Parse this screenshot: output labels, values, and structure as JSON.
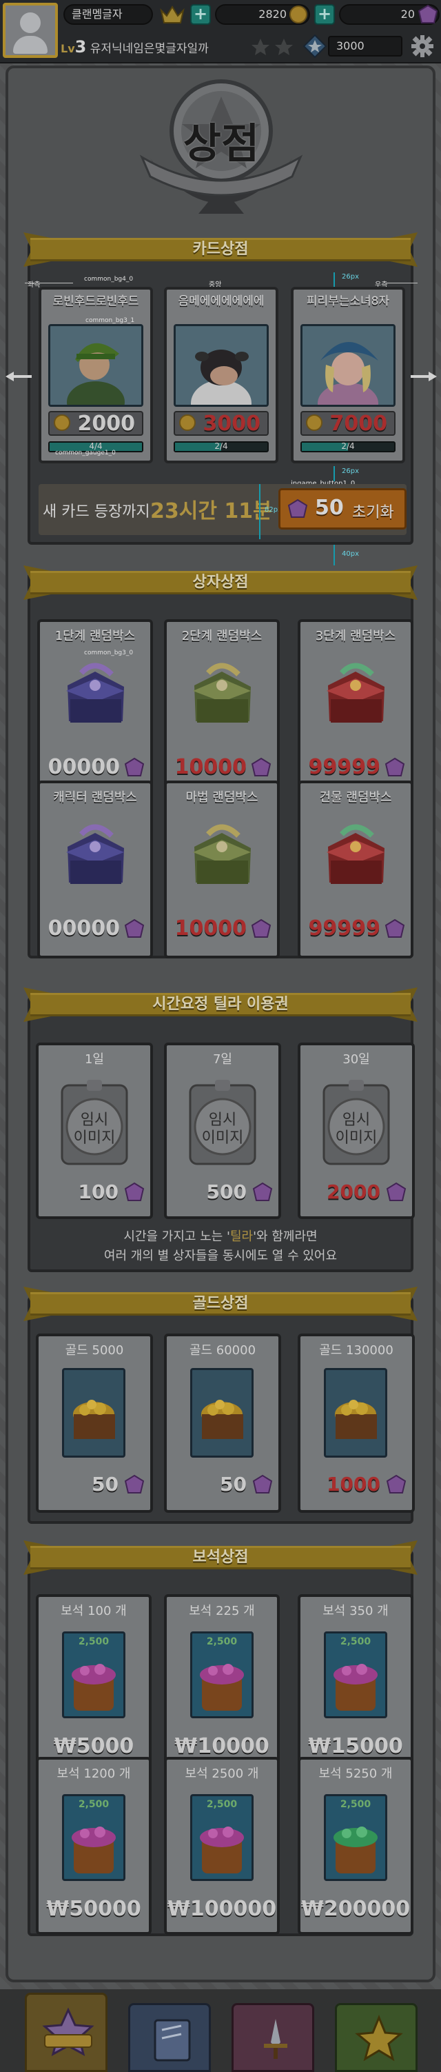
{
  "header": {
    "username": "클랜멤글자",
    "gold": "2820",
    "gems": "20",
    "level_prefix": "Lv",
    "level": "3",
    "nickname": "유저닉네임은몇글자일까",
    "rating": "3000"
  },
  "page_title": "상점",
  "card_shop": {
    "title": "카드상점",
    "annotations": {
      "left": "좌측",
      "center": "중앙",
      "right": "우측",
      "bg4": "common_bg4_0",
      "bg3": "common_bg3_1",
      "gauge": "common_gauge1_0",
      "btn": "ingame_button1_0",
      "gap26a": "26px",
      "gap26b": "26px",
      "gap82": "82px",
      "gap40": "40px",
      "gap14": "14px"
    },
    "cards": [
      {
        "name": "로빈후드로빈후드",
        "price": "2000",
        "gauge": "4/4",
        "progress": 1.0
      },
      {
        "name": "음메에에에에에에",
        "price": "3000",
        "gauge": "2/4",
        "progress": 0.5
      },
      {
        "name": "피리부는소녀8자",
        "price": "7000",
        "gauge": "2/4",
        "progress": 0.5
      }
    ],
    "timer_label": "새 카드 등장까지",
    "timer_value": "23시간 11분",
    "reset_count": "50",
    "reset_label": "초기화"
  },
  "box_shop": {
    "title": "상자상점",
    "annotation": "common_bg3_0",
    "boxes": [
      {
        "name": "1단계 랜덤박스",
        "price": "00000"
      },
      {
        "name": "2단계 랜덤박스",
        "price": "10000"
      },
      {
        "name": "3단계 랜덤박스",
        "price": "99999"
      },
      {
        "name": "캐릭터 랜덤박스",
        "price": "00000"
      },
      {
        "name": "마법 랜덤박스",
        "price": "10000"
      },
      {
        "name": "건물 랜덤박스",
        "price": "99999"
      }
    ]
  },
  "ticket_shop": {
    "title": "시간요정 틸라 이용권",
    "tickets": [
      {
        "name": "1일",
        "price": "100",
        "glyph": "임시\n이미지"
      },
      {
        "name": "7일",
        "price": "500",
        "glyph": "임시\n이미지"
      },
      {
        "name": "30일",
        "price": "2000",
        "glyph": "임시\n이미지"
      }
    ],
    "desc_line1_a": "시간을 가지고 노는 '",
    "desc_highlight": "틸라",
    "desc_line1_b": "'와 함께라면",
    "desc_line2": "여러 개의 별 상자들을 동시에도 열 수 있어요"
  },
  "gold_shop": {
    "title": "골드상점",
    "items": [
      {
        "name": "골드 5000",
        "price": "50"
      },
      {
        "name": "골드 60000",
        "price": "50"
      },
      {
        "name": "골드 130000",
        "price": "1000"
      }
    ]
  },
  "gem_shop": {
    "title": "보석상점",
    "items": [
      {
        "name": "보석 100 개",
        "price": "₩5000"
      },
      {
        "name": "보석 225 개",
        "price": "₩10000"
      },
      {
        "name": "보석 350 개",
        "price": "₩15000"
      },
      {
        "name": "보석 1200 개",
        "price": "₩50000"
      },
      {
        "name": "보석 2500 개",
        "price": "₩100000"
      },
      {
        "name": "보석 5250 개",
        "price": "₩200000"
      }
    ],
    "tag": "2,500"
  },
  "colors": {
    "gold": "#c7a033",
    "red_price": "#c03434",
    "teal": "#22897d",
    "ribbon": "#9e8124"
  }
}
